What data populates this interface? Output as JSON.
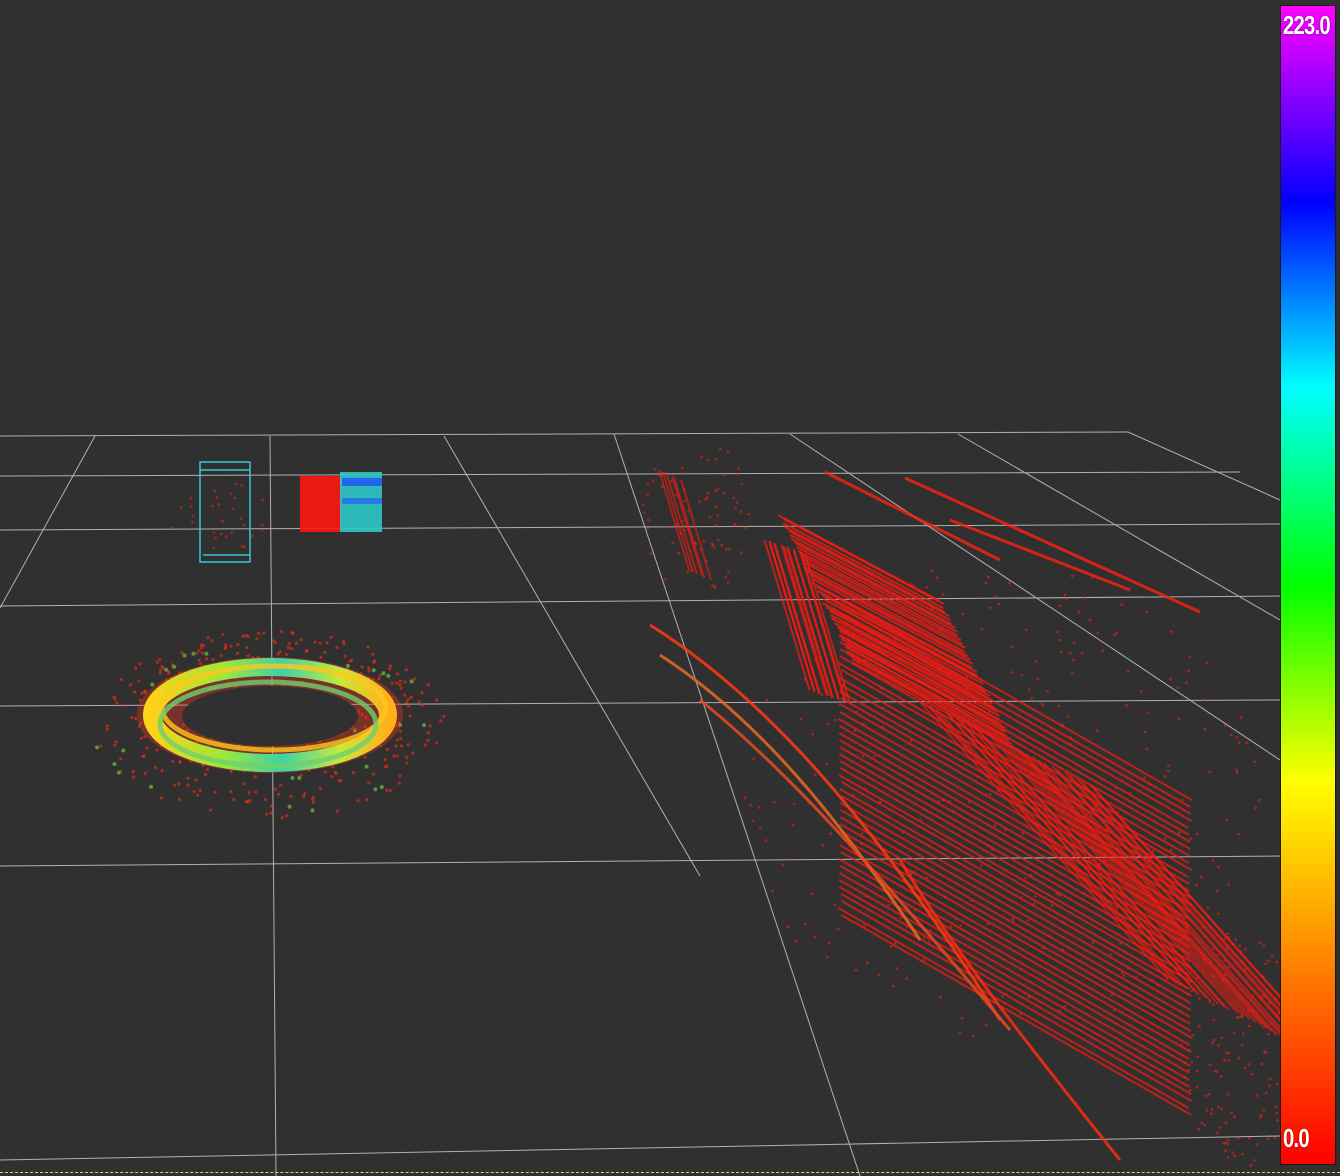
{
  "viewer": {
    "background_color": "#303030",
    "grid_color": "#c8c8c8"
  },
  "colorbar": {
    "max_label": "223.0",
    "min_label": "0.0",
    "stops": [
      "#ff0000",
      "#ff8000",
      "#ffff00",
      "#00ff00",
      "#00ffff",
      "#0000ff",
      "#ff00ff"
    ]
  },
  "scene": {
    "objects": [
      {
        "name": "bounding-box",
        "color": "#33c8d8"
      },
      {
        "name": "intensity-ring",
        "colors": [
          "#ffd21a",
          "#9de83a",
          "#3fd1a8",
          "#ff8a1a"
        ]
      },
      {
        "name": "wall-points",
        "color": "#ff1a10"
      },
      {
        "name": "curb-line",
        "color": "#e86a20"
      }
    ]
  }
}
